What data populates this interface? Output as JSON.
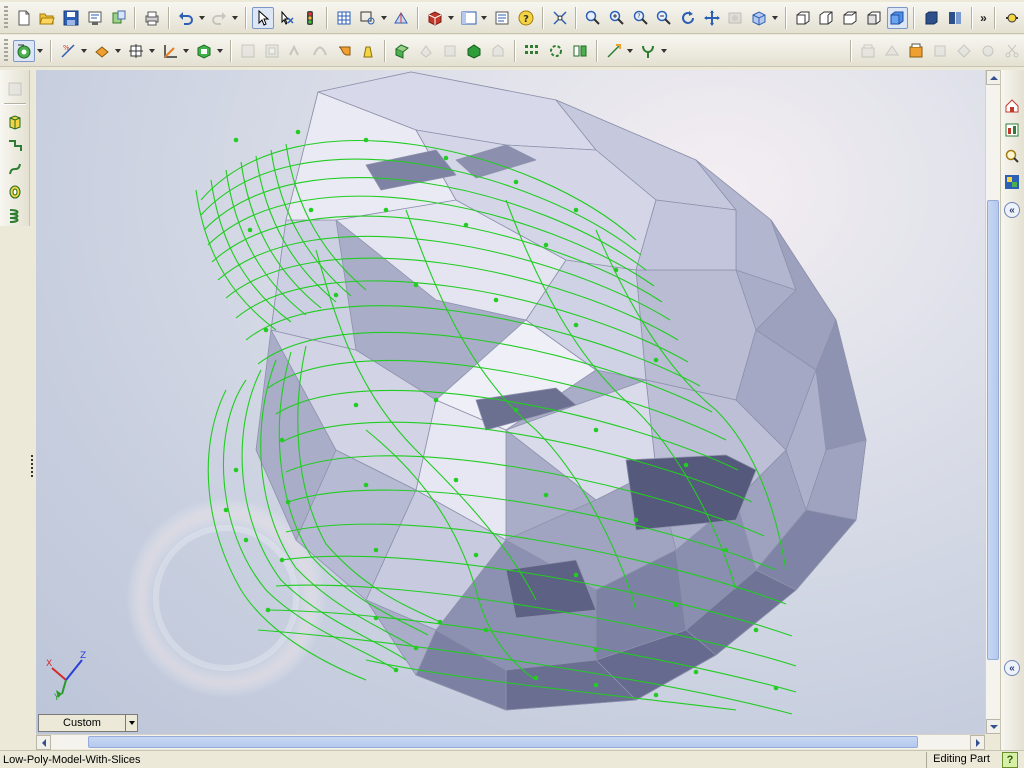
{
  "view": {
    "display_style": "Custom"
  },
  "status": {
    "document_name": "Low-Poly-Model-With-Slices",
    "mode": "Editing Part",
    "help_label": "?"
  },
  "colors": {
    "slice_wire": "#22cc22",
    "model_face": "#a9adc8",
    "selected_tool": "#dde6f5"
  },
  "toolbars": {
    "standard": [
      "new-document",
      "open",
      "save",
      "print-preview",
      "options",
      "print",
      "undo",
      "redo",
      "select",
      "filter",
      "rebuild",
      "grid",
      "sketch",
      "feature",
      "3d-sketch",
      "layout",
      "properties",
      "help"
    ],
    "view": [
      "zoom-to-fit",
      "zoom-to-area",
      "zoom-in-out",
      "zoom-to-selection",
      "rotate-view",
      "pan",
      "render",
      "section-view",
      "front-view",
      "back-view",
      "right-view",
      "isometric-view",
      "shaded-view",
      "perspective",
      "shadow"
    ],
    "features": [
      "display-style",
      "reference-geometry",
      "surface",
      "curves",
      "instant-3d",
      "fillet",
      "chamfer",
      "shell",
      "draft",
      "sweep",
      "loft",
      "extrude",
      "revolve",
      "pattern",
      "mirror",
      "dimension",
      "smart-tools"
    ],
    "right_features": [
      "sketch-entities",
      "sheet-metal",
      "drawing",
      "weldments",
      "mold-tools",
      "simulation"
    ],
    "left": [
      "hide-panel",
      "extruded-boss",
      "sketch-path",
      "spline",
      "helix",
      "coil"
    ],
    "taskpane": [
      "resources-home",
      "design-library",
      "file-explorer",
      "view-palette"
    ]
  }
}
